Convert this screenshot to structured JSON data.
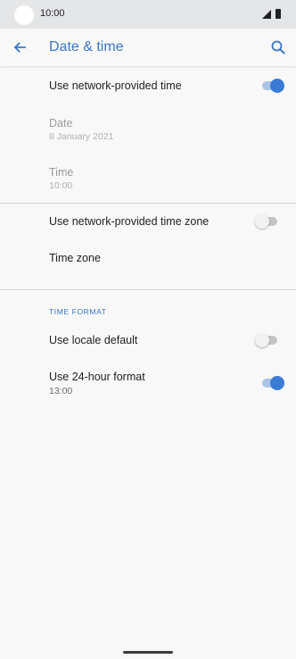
{
  "status_bar": {
    "time": "10:00"
  },
  "app_bar": {
    "title": "Date & time"
  },
  "rows": {
    "network_time": {
      "title": "Use network-provided time",
      "switch_on": true
    },
    "date": {
      "title": "Date",
      "value": "8 January 2021"
    },
    "time": {
      "title": "Time",
      "value": "10:00"
    },
    "network_time_zone": {
      "title": "Use network-provided time zone",
      "switch_on": false
    },
    "time_zone": {
      "title": "Time zone"
    },
    "locale_default": {
      "title": "Use locale default",
      "switch_on": false
    },
    "hour_24": {
      "title": "Use 24-hour format",
      "value": "13:00",
      "switch_on": true
    }
  },
  "sections": {
    "time_format": "TIME FORMAT"
  },
  "colors": {
    "accent": "#3a75c4",
    "switch_on": "#3a7bd5",
    "background": "#f8f8f9"
  }
}
